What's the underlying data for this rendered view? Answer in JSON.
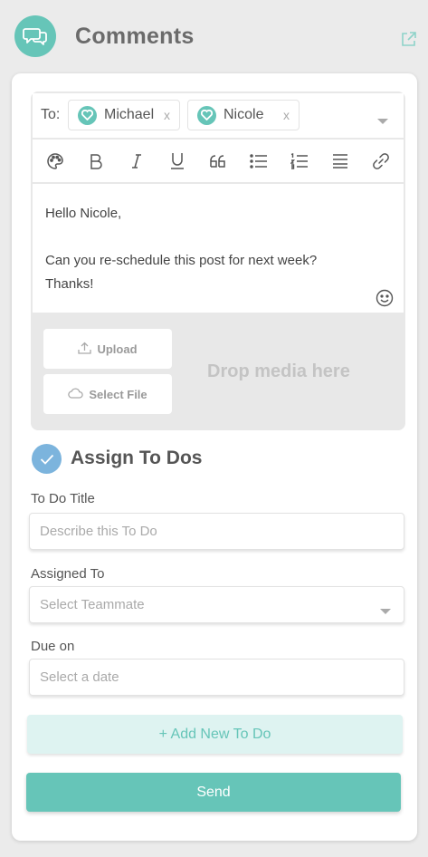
{
  "header": {
    "title": "Comments",
    "icon": "chat-bubbles-icon",
    "external_icon": "external-link-icon"
  },
  "colors": {
    "accent": "#66c5b8",
    "check": "#7cb4dd",
    "background": "#ebebeb"
  },
  "composer": {
    "to_label": "To:",
    "recipients": [
      {
        "name": "Michael",
        "remove": "x"
      },
      {
        "name": "Nicole",
        "remove": "x"
      }
    ],
    "toolbar": [
      "palette-icon",
      "bold-icon",
      "italic-icon",
      "underline-icon",
      "quote-icon",
      "bullet-list-icon",
      "numbered-list-icon",
      "align-icon",
      "link-icon"
    ],
    "body_lines": [
      "Hello Nicole,",
      "",
      "Can you re-schedule this post for next week?",
      "Thanks!"
    ],
    "upload_label": "Upload",
    "select_file_label": "Select File",
    "drop_text": "Drop media here"
  },
  "todo": {
    "assign_title": "Assign To Dos",
    "title_label": "To Do Title",
    "title_placeholder": "Describe this To Do",
    "assigned_label": "Assigned To",
    "assigned_placeholder": "Select Teammate",
    "due_label": "Due on",
    "due_placeholder": "Select a date",
    "add_label": "+ Add New To Do"
  },
  "send_label": "Send"
}
